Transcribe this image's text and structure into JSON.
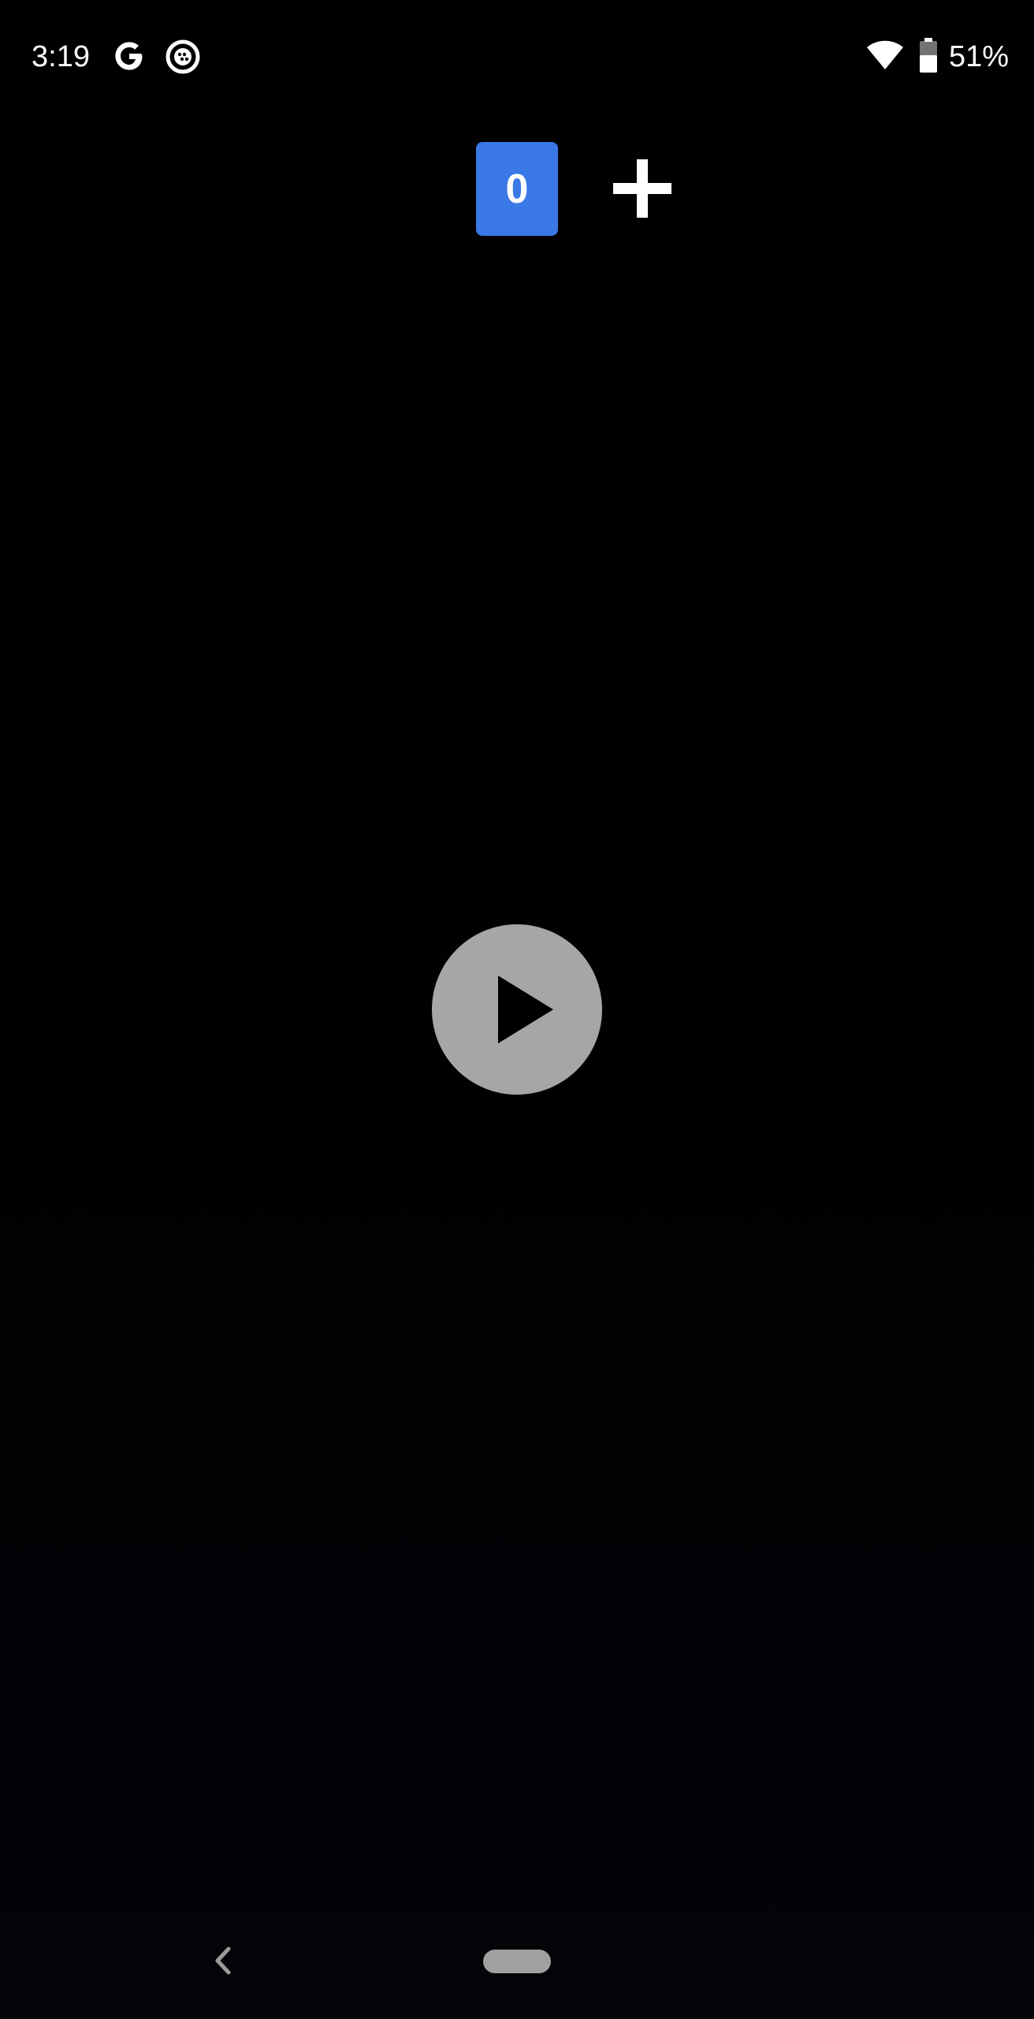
{
  "status_bar": {
    "time": "3:19",
    "battery_percent": "51%",
    "icons": [
      "google-icon",
      "camera-app-icon",
      "wifi-icon",
      "battery-icon"
    ]
  },
  "counter": {
    "value": "0",
    "color": "#3a78e6"
  },
  "controls": {
    "add_icon": "plus-icon",
    "play_icon": "play-icon",
    "play_button_color": "#a6a6a6"
  },
  "nav_bar": {
    "icons": [
      "back-icon",
      "home-pill"
    ]
  }
}
